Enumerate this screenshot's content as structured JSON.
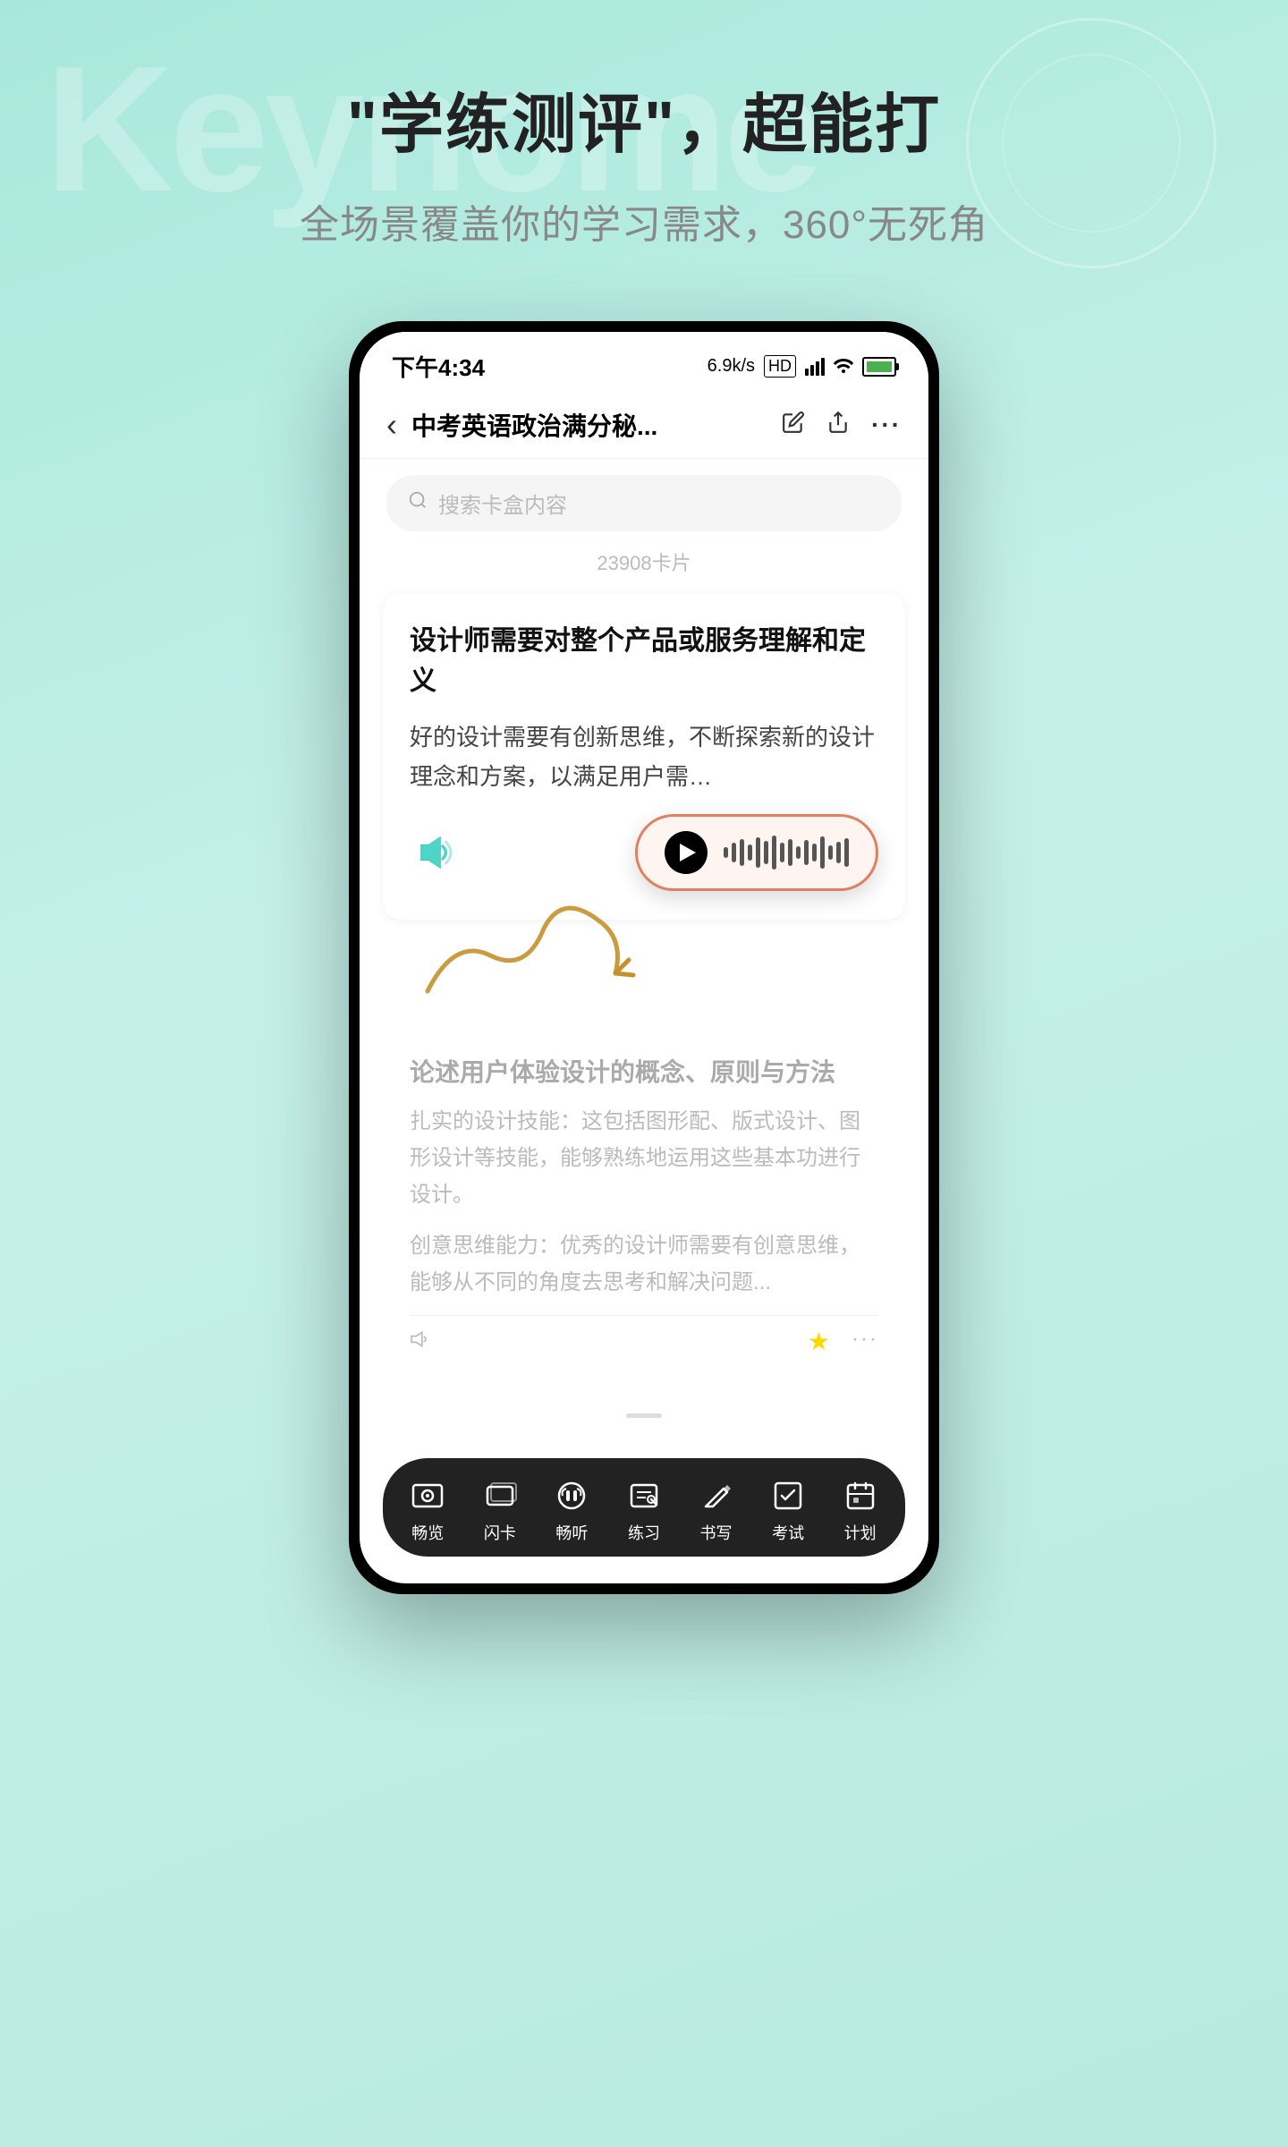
{
  "background": {
    "watermark_text": "Keynome",
    "gradient_start": "#a8e8dc",
    "gradient_end": "#b8eae0"
  },
  "headline": "\"学练测评\"，超能打",
  "subheadline": "全场景覆盖你的学习需求，360°无死角",
  "phone": {
    "status_bar": {
      "time": "下午4:34",
      "speed": "6.9k/s",
      "hd_label": "HD",
      "battery_percent": "88"
    },
    "nav_bar": {
      "back_icon": "‹",
      "title": "中考英语政治满分秘...",
      "edit_icon": "✏",
      "share_icon": "↑",
      "more_icon": "···"
    },
    "search": {
      "placeholder": "搜索卡盒内容"
    },
    "card_count": "23908卡片",
    "main_card": {
      "title": "设计师需要对整个产品或服务理解和定义",
      "body": "好的设计需要有创新思维，不断探索新的设计理念和方案，以满足用户需…"
    },
    "audio_pill": {
      "waveform_label": "播放音频"
    },
    "blurred_card": {
      "title": "论述用户体验设计的概念、原则与方法",
      "body1": "扎实的设计技能：这包括图形配、版式设计、图形设计等技能，能够熟练地运用这些基本功进行设计。",
      "body2": "创意思维能力：优秀的设计师需要有创意思维，能够从不同的角度去思考和解决问题..."
    },
    "bottom_nav": {
      "items": [
        {
          "icon": "browse",
          "label": "畅览"
        },
        {
          "icon": "flashcard",
          "label": "闪卡"
        },
        {
          "icon": "listen",
          "label": "畅听"
        },
        {
          "icon": "practice",
          "label": "练习"
        },
        {
          "icon": "write",
          "label": "书写"
        },
        {
          "icon": "test",
          "label": "考试"
        },
        {
          "icon": "plan",
          "label": "计划"
        }
      ]
    }
  }
}
